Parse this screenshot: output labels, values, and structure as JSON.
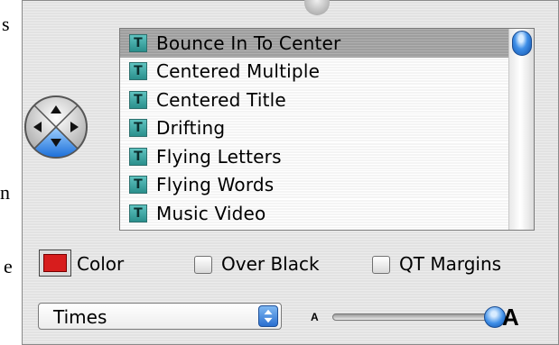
{
  "doc_margin_chars": [
    "s",
    "n",
    "e"
  ],
  "titles_list": {
    "items": [
      {
        "label": "Bounce In To Center",
        "selected": true
      },
      {
        "label": "Centered Multiple",
        "selected": false
      },
      {
        "label": "Centered Title",
        "selected": false
      },
      {
        "label": "Drifting",
        "selected": false
      },
      {
        "label": "Flying Letters",
        "selected": false
      },
      {
        "label": "Flying Words",
        "selected": false
      },
      {
        "label": "Music Video",
        "selected": false
      }
    ],
    "item_icon": "title-t-icon",
    "icon_letter": "T"
  },
  "direction_pad": {
    "icon": "direction-pad-icon",
    "active_direction": "down"
  },
  "options": {
    "color_label": "Color",
    "color_value": "#d71d1d",
    "over_black_label": "Over Black",
    "over_black_checked": false,
    "qt_margins_label": "QT Margins",
    "qt_margins_checked": false
  },
  "font": {
    "selected": "Times"
  },
  "size_slider": {
    "small_label": "A",
    "large_label": "A",
    "value_fraction": 1.0
  },
  "colors": {
    "accent": "#3f8fe8",
    "selection": "#a7a7a7",
    "panel": "#e2e2e2"
  }
}
